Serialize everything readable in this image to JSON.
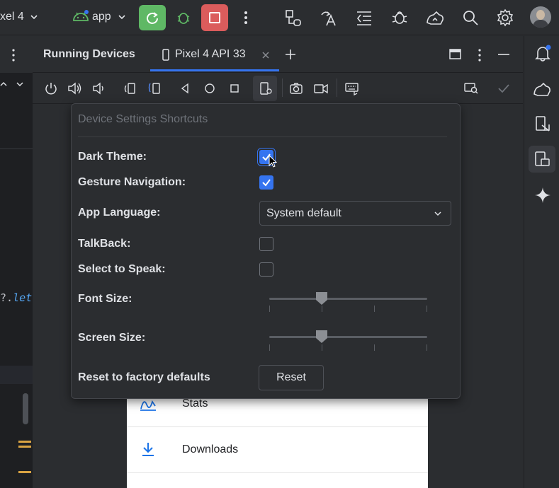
{
  "topbar": {
    "device_label": "xel 4",
    "run_config": "app"
  },
  "editor": {
    "code_fragment_prefix": "?.",
    "code_fragment_keyword": "let"
  },
  "running_devices": {
    "title": "Running Devices",
    "tab_label": "Pixel 4 API 33"
  },
  "popup": {
    "title": "Device Settings Shortcuts",
    "dark_theme_label": "Dark Theme:",
    "dark_theme_checked": true,
    "gesture_nav_label": "Gesture Navigation:",
    "gesture_nav_checked": true,
    "app_language_label": "App Language:",
    "app_language_value": "System default",
    "talkback_label": "TalkBack:",
    "talkback_checked": false,
    "select_to_speak_label": "Select to Speak:",
    "select_to_speak_checked": false,
    "font_size_label": "Font Size:",
    "screen_size_label": "Screen Size:",
    "reset_label": "Reset to factory defaults",
    "reset_button": "Reset"
  },
  "phone": {
    "item1": "Stats",
    "item2": "Downloads"
  },
  "colors": {
    "accent": "#3574f0",
    "run_button": "#5fb865",
    "stop_button": "#db5c5c",
    "phone_icon": "#1a73e8"
  }
}
